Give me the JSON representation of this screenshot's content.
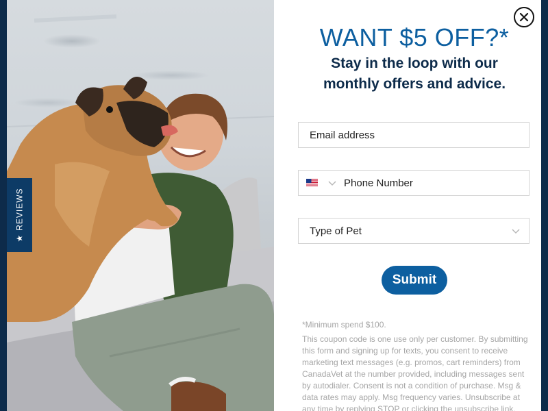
{
  "popup": {
    "headline": "WANT $5 OFF?*",
    "subheadline_line1": "Stay in the loop with our",
    "subheadline_line2": "monthly offers and advice.",
    "close_icon": "close-icon"
  },
  "reviews_tab": {
    "label": "REVIEWS",
    "star": "★"
  },
  "form": {
    "email_placeholder": "Email address",
    "phone_placeholder": "Phone Number",
    "phone_country_flag": "us-flag-icon",
    "pet_type_placeholder": "Type of Pet",
    "submit_label": "Submit"
  },
  "disclaimer": {
    "minimum_spend": "*Minimum spend $100.",
    "terms": "This coupon code is one use only per customer. By submitting this form and signing up for texts, you consent to receive marketing text messages (e.g. promos, cart reminders) from CanadaVet at the number provided, including messages sent by autodialer. Consent is not a condition of purchase. Msg & data rates may apply. Msg frequency varies. Unsubscribe at any time by replying STOP or clicking the unsubscribe link."
  },
  "colors": {
    "brand_blue": "#0d5fa0",
    "navy": "#0d2b4a",
    "tab_navy": "#0d3b66"
  }
}
